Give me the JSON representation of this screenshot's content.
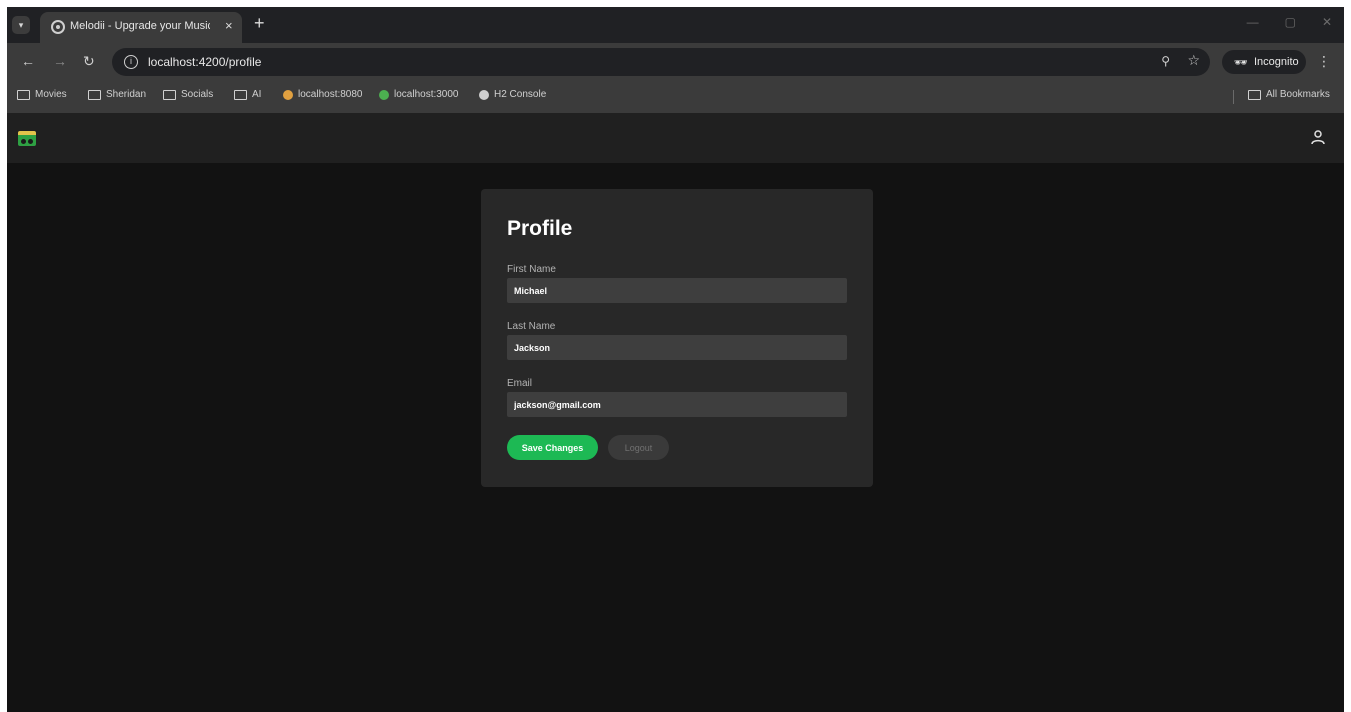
{
  "browser": {
    "tab_title": "Melodii - Upgrade your Music",
    "tab_close": "×",
    "new_tab": "+",
    "url": "localhost:4200/profile",
    "incognito_label": "Incognito",
    "bookmarks": [
      {
        "label": "Movies",
        "icon": "folder-icon"
      },
      {
        "label": "Sheridan",
        "icon": "folder-icon"
      },
      {
        "label": "Socials",
        "icon": "folder-icon"
      },
      {
        "label": "AI",
        "icon": "folder-icon"
      },
      {
        "label": "localhost:8080",
        "icon": "spring-leaf-icon"
      },
      {
        "label": "localhost:3000",
        "icon": "leaf-icon"
      },
      {
        "label": "H2 Console",
        "icon": "globe-icon"
      }
    ],
    "all_bookmarks": "All Bookmarks"
  },
  "profile": {
    "title": "Profile",
    "first_name_label": "First Name",
    "first_name_value": "Michael",
    "last_name_label": "Last Name",
    "last_name_value": "Jackson",
    "email_label": "Email",
    "email_value": "jackson@gmail.com",
    "save_label": "Save Changes",
    "logout_label": "Logout"
  },
  "colors": {
    "accent": "#1db954",
    "page_bg": "#121212",
    "card_bg": "#282828",
    "header_bg": "#202020"
  }
}
